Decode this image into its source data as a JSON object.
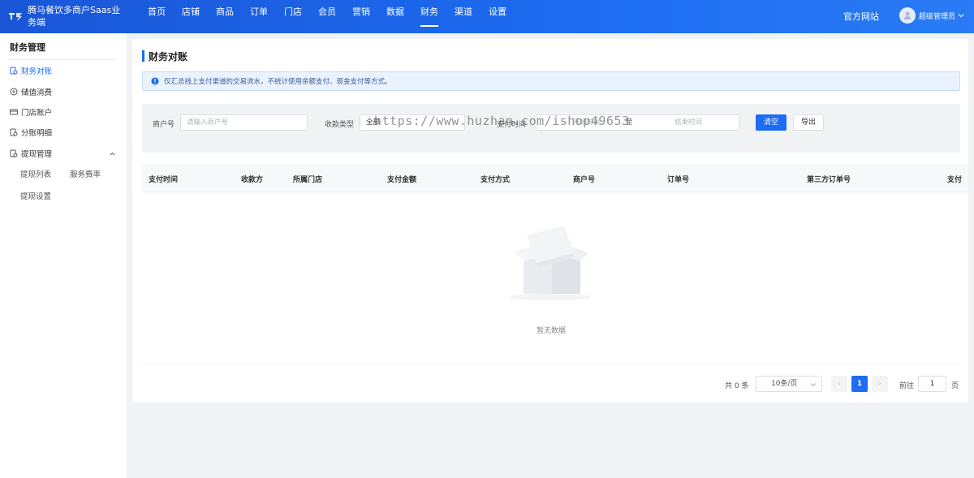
{
  "header": {
    "app_title": "腾马餐饮多商户Saas业务端",
    "nav": [
      {
        "label": "首页"
      },
      {
        "label": "店铺"
      },
      {
        "label": "商品"
      },
      {
        "label": "订单"
      },
      {
        "label": "门店"
      },
      {
        "label": "会员"
      },
      {
        "label": "营销"
      },
      {
        "label": "数据"
      },
      {
        "label": "财务",
        "active": true
      },
      {
        "label": "渠道"
      },
      {
        "label": "设置"
      }
    ],
    "official_site": "官方网站",
    "user_name": "超级管理员"
  },
  "sidebar": {
    "title": "财务管理",
    "items": [
      {
        "label": "财务对账",
        "icon": "finance-icon",
        "active": true
      },
      {
        "label": "储值消费",
        "icon": "stored-value-icon"
      },
      {
        "label": "门店账户",
        "icon": "card-icon"
      },
      {
        "label": "分账明细",
        "icon": "split-account-icon"
      },
      {
        "label": "提现管理",
        "icon": "withdraw-icon",
        "expanded": true
      }
    ],
    "sub_items": [
      {
        "label": "提现列表"
      },
      {
        "label": "服务费率"
      },
      {
        "label": "提现设置"
      }
    ]
  },
  "main": {
    "title": "财务对账",
    "notice": "仅汇总线上支付渠道的交易流水，不统计使用余额支付、现金支付等方式。",
    "filter": {
      "merchant_label": "商户号",
      "merchant_placeholder": "请输入商户号",
      "type_label": "收款类型",
      "type_value": "全部",
      "time_label": "支付时间",
      "start_placeholder": "开始时间",
      "range_sep": "至",
      "end_placeholder": "结束时间",
      "clear_button": "清空",
      "export_button": "导出"
    },
    "watermark": "https://www.huzhan.com/ishop49653",
    "table": {
      "columns": [
        "支付时间",
        "收款方",
        "所属门店",
        "支付金额",
        "支付方式",
        "商户号",
        "订单号",
        "第三方订单号",
        "支付"
      ],
      "rows": [],
      "empty_text": "暂无数据"
    },
    "pagination": {
      "total_text": "共 0 条",
      "page_size": "10条/页",
      "prev": "‹",
      "current_page": "1",
      "next": "›",
      "goto_label": "前往",
      "goto_value": "1",
      "page_suffix": "页"
    }
  },
  "colors": {
    "primary": "#1d6cf2",
    "notice_bg": "#e9f2fd"
  }
}
